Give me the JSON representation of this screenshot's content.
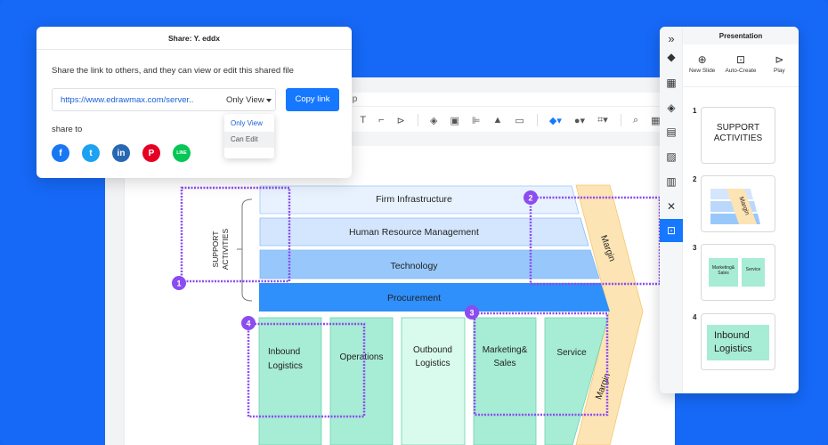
{
  "share_dialog": {
    "title": "Share: Y. eddx",
    "description": "Share the link to others, and they can view or edit this shared file",
    "link_url": "https://www.edrawmax.com/server..",
    "permission_selected": "Only View",
    "copy_button": "Copy link",
    "share_to_label": "share to",
    "permission_options": [
      "Only View",
      "Can Edit"
    ],
    "socials": [
      {
        "name": "facebook",
        "glyph": "f",
        "color": "#1877f2"
      },
      {
        "name": "twitter",
        "glyph": "t",
        "color": "#1da1f2"
      },
      {
        "name": "linkedin",
        "glyph": "in",
        "color": "#2867b2"
      },
      {
        "name": "pinterest",
        "glyph": "P",
        "color": "#e60023"
      },
      {
        "name": "line",
        "glyph": "LINE",
        "color": "#06c755"
      }
    ]
  },
  "editor": {
    "menu_partial": "elp"
  },
  "diagram": {
    "support_label_line1": "SUPPORT",
    "support_label_line2": "ACTIVITIES",
    "support_rows": [
      "Firm Infrastructure",
      "Human Resource Management",
      "Technology",
      "Procurement"
    ],
    "primary_line1": [
      "Inbound",
      "Operations",
      "Outbound",
      "Marketing&",
      "Service"
    ],
    "primary_line2": [
      "Logistics",
      "",
      "Logistics",
      "Sales",
      ""
    ],
    "margin_label": "Margin",
    "callouts": [
      "1",
      "2",
      "3",
      "4"
    ],
    "colors": {
      "row1": "#e8f2fe",
      "row2": "#d4e6fd",
      "row3": "#98c8fb",
      "row4": "#2f8ffb",
      "primary": "#a7ecd4",
      "primary_light": "#d8fbee",
      "margin": "#fde4b5",
      "callout": "#8b4cf0"
    }
  },
  "presentation": {
    "title": "Presentation",
    "actions": [
      {
        "label": "New Slide",
        "icon": "plus-circle-icon"
      },
      {
        "label": "Auto-Create",
        "icon": "easel-icon"
      },
      {
        "label": "Play",
        "icon": "play-icon"
      }
    ],
    "slides": [
      {
        "number": "1",
        "line1": "SUPPORT",
        "line2": "ACTIVITIES"
      },
      {
        "number": "2",
        "margin": "Margin"
      },
      {
        "number": "3",
        "box1a": "Marketing&",
        "box1b": "Sales",
        "box2": "Service"
      },
      {
        "number": "4",
        "line1": "Inbound",
        "line2": "Logistics"
      }
    ]
  }
}
